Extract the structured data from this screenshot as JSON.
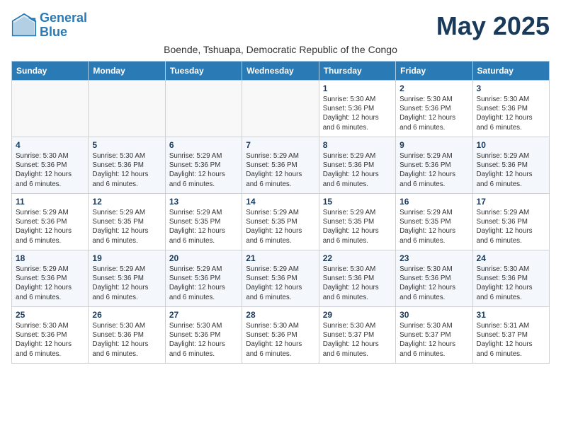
{
  "logo": {
    "line1": "General",
    "line2": "Blue"
  },
  "title": "May 2025",
  "subtitle": "Boende, Tshuapa, Democratic Republic of the Congo",
  "weekdays": [
    "Sunday",
    "Monday",
    "Tuesday",
    "Wednesday",
    "Thursday",
    "Friday",
    "Saturday"
  ],
  "weeks": [
    [
      {
        "day": "",
        "info": ""
      },
      {
        "day": "",
        "info": ""
      },
      {
        "day": "",
        "info": ""
      },
      {
        "day": "",
        "info": ""
      },
      {
        "day": "1",
        "info": "Sunrise: 5:30 AM\nSunset: 5:36 PM\nDaylight: 12 hours\nand 6 minutes."
      },
      {
        "day": "2",
        "info": "Sunrise: 5:30 AM\nSunset: 5:36 PM\nDaylight: 12 hours\nand 6 minutes."
      },
      {
        "day": "3",
        "info": "Sunrise: 5:30 AM\nSunset: 5:36 PM\nDaylight: 12 hours\nand 6 minutes."
      }
    ],
    [
      {
        "day": "4",
        "info": "Sunrise: 5:30 AM\nSunset: 5:36 PM\nDaylight: 12 hours\nand 6 minutes."
      },
      {
        "day": "5",
        "info": "Sunrise: 5:30 AM\nSunset: 5:36 PM\nDaylight: 12 hours\nand 6 minutes."
      },
      {
        "day": "6",
        "info": "Sunrise: 5:29 AM\nSunset: 5:36 PM\nDaylight: 12 hours\nand 6 minutes."
      },
      {
        "day": "7",
        "info": "Sunrise: 5:29 AM\nSunset: 5:36 PM\nDaylight: 12 hours\nand 6 minutes."
      },
      {
        "day": "8",
        "info": "Sunrise: 5:29 AM\nSunset: 5:36 PM\nDaylight: 12 hours\nand 6 minutes."
      },
      {
        "day": "9",
        "info": "Sunrise: 5:29 AM\nSunset: 5:36 PM\nDaylight: 12 hours\nand 6 minutes."
      },
      {
        "day": "10",
        "info": "Sunrise: 5:29 AM\nSunset: 5:36 PM\nDaylight: 12 hours\nand 6 minutes."
      }
    ],
    [
      {
        "day": "11",
        "info": "Sunrise: 5:29 AM\nSunset: 5:36 PM\nDaylight: 12 hours\nand 6 minutes."
      },
      {
        "day": "12",
        "info": "Sunrise: 5:29 AM\nSunset: 5:35 PM\nDaylight: 12 hours\nand 6 minutes."
      },
      {
        "day": "13",
        "info": "Sunrise: 5:29 AM\nSunset: 5:35 PM\nDaylight: 12 hours\nand 6 minutes."
      },
      {
        "day": "14",
        "info": "Sunrise: 5:29 AM\nSunset: 5:35 PM\nDaylight: 12 hours\nand 6 minutes."
      },
      {
        "day": "15",
        "info": "Sunrise: 5:29 AM\nSunset: 5:35 PM\nDaylight: 12 hours\nand 6 minutes."
      },
      {
        "day": "16",
        "info": "Sunrise: 5:29 AM\nSunset: 5:35 PM\nDaylight: 12 hours\nand 6 minutes."
      },
      {
        "day": "17",
        "info": "Sunrise: 5:29 AM\nSunset: 5:36 PM\nDaylight: 12 hours\nand 6 minutes."
      }
    ],
    [
      {
        "day": "18",
        "info": "Sunrise: 5:29 AM\nSunset: 5:36 PM\nDaylight: 12 hours\nand 6 minutes."
      },
      {
        "day": "19",
        "info": "Sunrise: 5:29 AM\nSunset: 5:36 PM\nDaylight: 12 hours\nand 6 minutes."
      },
      {
        "day": "20",
        "info": "Sunrise: 5:29 AM\nSunset: 5:36 PM\nDaylight: 12 hours\nand 6 minutes."
      },
      {
        "day": "21",
        "info": "Sunrise: 5:29 AM\nSunset: 5:36 PM\nDaylight: 12 hours\nand 6 minutes."
      },
      {
        "day": "22",
        "info": "Sunrise: 5:30 AM\nSunset: 5:36 PM\nDaylight: 12 hours\nand 6 minutes."
      },
      {
        "day": "23",
        "info": "Sunrise: 5:30 AM\nSunset: 5:36 PM\nDaylight: 12 hours\nand 6 minutes."
      },
      {
        "day": "24",
        "info": "Sunrise: 5:30 AM\nSunset: 5:36 PM\nDaylight: 12 hours\nand 6 minutes."
      }
    ],
    [
      {
        "day": "25",
        "info": "Sunrise: 5:30 AM\nSunset: 5:36 PM\nDaylight: 12 hours\nand 6 minutes."
      },
      {
        "day": "26",
        "info": "Sunrise: 5:30 AM\nSunset: 5:36 PM\nDaylight: 12 hours\nand 6 minutes."
      },
      {
        "day": "27",
        "info": "Sunrise: 5:30 AM\nSunset: 5:36 PM\nDaylight: 12 hours\nand 6 minutes."
      },
      {
        "day": "28",
        "info": "Sunrise: 5:30 AM\nSunset: 5:36 PM\nDaylight: 12 hours\nand 6 minutes."
      },
      {
        "day": "29",
        "info": "Sunrise: 5:30 AM\nSunset: 5:37 PM\nDaylight: 12 hours\nand 6 minutes."
      },
      {
        "day": "30",
        "info": "Sunrise: 5:30 AM\nSunset: 5:37 PM\nDaylight: 12 hours\nand 6 minutes."
      },
      {
        "day": "31",
        "info": "Sunrise: 5:31 AM\nSunset: 5:37 PM\nDaylight: 12 hours\nand 6 minutes."
      }
    ]
  ]
}
